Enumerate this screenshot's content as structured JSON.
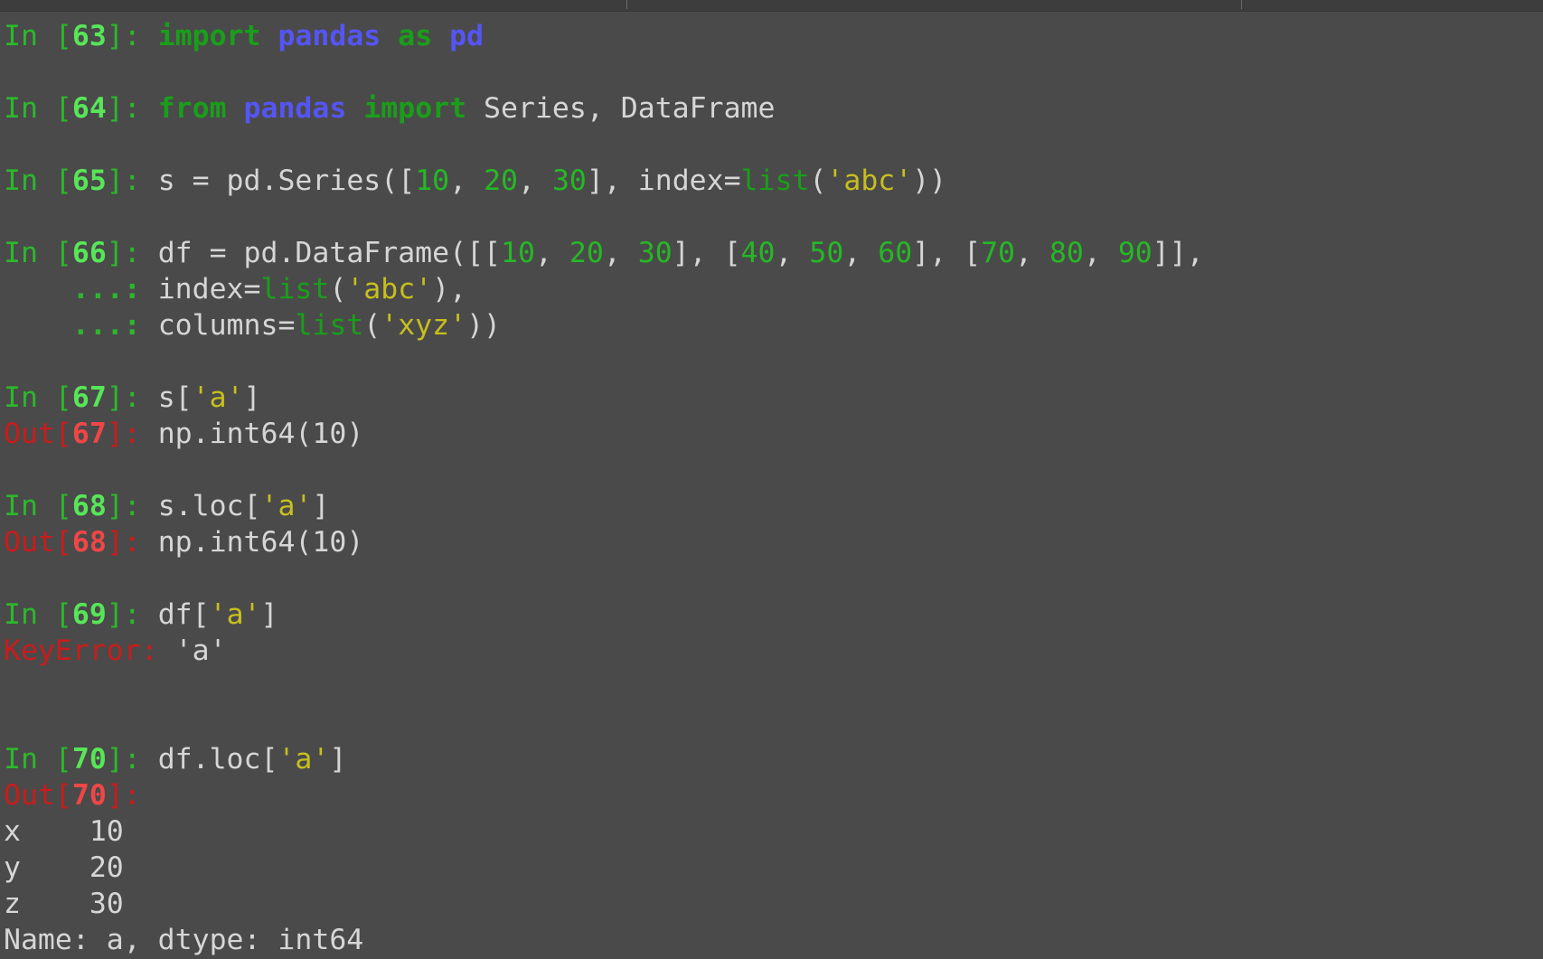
{
  "terminal": {
    "background": "#4a4a4a",
    "lines": [
      [
        [
          "tok-prompt-in",
          "In ["
        ],
        [
          "tok-prompt-num",
          "63"
        ],
        [
          "tok-prompt-in",
          "]: "
        ],
        [
          "tok-kw",
          "import"
        ],
        [
          "tok-plain",
          " "
        ],
        [
          "tok-mod",
          "pandas"
        ],
        [
          "tok-plain",
          " "
        ],
        [
          "tok-kw",
          "as"
        ],
        [
          "tok-plain",
          " "
        ],
        [
          "tok-mod",
          "pd"
        ]
      ],
      [
        [
          "tok-prompt-in",
          "In ["
        ],
        [
          "tok-prompt-num",
          "64"
        ],
        [
          "tok-prompt-in",
          "]: "
        ],
        [
          "tok-kw",
          "from"
        ],
        [
          "tok-plain",
          " "
        ],
        [
          "tok-mod",
          "pandas"
        ],
        [
          "tok-plain",
          " "
        ],
        [
          "tok-kw",
          "import"
        ],
        [
          "tok-plain",
          " Series, DataFrame"
        ]
      ],
      [
        [
          "tok-prompt-in",
          "In ["
        ],
        [
          "tok-prompt-num",
          "65"
        ],
        [
          "tok-prompt-in",
          "]: "
        ],
        [
          "tok-plain",
          "s = pd.Series(["
        ],
        [
          "tok-num",
          "10"
        ],
        [
          "tok-plain",
          ", "
        ],
        [
          "tok-num",
          "20"
        ],
        [
          "tok-plain",
          ", "
        ],
        [
          "tok-num",
          "30"
        ],
        [
          "tok-plain",
          "], index="
        ],
        [
          "tok-builtin",
          "list"
        ],
        [
          "tok-plain",
          "("
        ],
        [
          "tok-str",
          "'abc'"
        ],
        [
          "tok-plain",
          "))"
        ]
      ],
      [
        [
          "tok-prompt-in",
          "In ["
        ],
        [
          "tok-prompt-num",
          "66"
        ],
        [
          "tok-prompt-in",
          "]: "
        ],
        [
          "tok-plain",
          "df = pd.DataFrame([["
        ],
        [
          "tok-num",
          "10"
        ],
        [
          "tok-plain",
          ", "
        ],
        [
          "tok-num",
          "20"
        ],
        [
          "tok-plain",
          ", "
        ],
        [
          "tok-num",
          "30"
        ],
        [
          "tok-plain",
          "], ["
        ],
        [
          "tok-num",
          "40"
        ],
        [
          "tok-plain",
          ", "
        ],
        [
          "tok-num",
          "50"
        ],
        [
          "tok-plain",
          ", "
        ],
        [
          "tok-num",
          "60"
        ],
        [
          "tok-plain",
          "], ["
        ],
        [
          "tok-num",
          "70"
        ],
        [
          "tok-plain",
          ", "
        ],
        [
          "tok-num",
          "80"
        ],
        [
          "tok-plain",
          ", "
        ],
        [
          "tok-num",
          "90"
        ],
        [
          "tok-plain",
          "]],"
        ]
      ],
      [
        [
          "tok-plain",
          "    "
        ],
        [
          "tok-cont",
          "...: "
        ],
        [
          "tok-plain",
          "index="
        ],
        [
          "tok-builtin",
          "list"
        ],
        [
          "tok-plain",
          "("
        ],
        [
          "tok-str",
          "'abc'"
        ],
        [
          "tok-plain",
          "),"
        ]
      ],
      [
        [
          "tok-plain",
          "    "
        ],
        [
          "tok-cont",
          "...: "
        ],
        [
          "tok-plain",
          "columns="
        ],
        [
          "tok-builtin",
          "list"
        ],
        [
          "tok-plain",
          "("
        ],
        [
          "tok-str",
          "'xyz'"
        ],
        [
          "tok-plain",
          "))"
        ]
      ],
      [
        [
          "tok-prompt-in",
          "In ["
        ],
        [
          "tok-prompt-num",
          "67"
        ],
        [
          "tok-prompt-in",
          "]: "
        ],
        [
          "tok-plain",
          "s["
        ],
        [
          "tok-str",
          "'a'"
        ],
        [
          "tok-plain",
          "]"
        ]
      ],
      [
        [
          "tok-out",
          "Out["
        ],
        [
          "tok-out-num",
          "67"
        ],
        [
          "tok-out",
          "]: "
        ],
        [
          "tok-plain",
          "np.int64(10)"
        ]
      ],
      [
        [
          "tok-prompt-in",
          "In ["
        ],
        [
          "tok-prompt-num",
          "68"
        ],
        [
          "tok-prompt-in",
          "]: "
        ],
        [
          "tok-plain",
          "s.loc["
        ],
        [
          "tok-str",
          "'a'"
        ],
        [
          "tok-plain",
          "]"
        ]
      ],
      [
        [
          "tok-out",
          "Out["
        ],
        [
          "tok-out-num",
          "68"
        ],
        [
          "tok-out",
          "]: "
        ],
        [
          "tok-plain",
          "np.int64(10)"
        ]
      ],
      [
        [
          "tok-prompt-in",
          "In ["
        ],
        [
          "tok-prompt-num",
          "69"
        ],
        [
          "tok-prompt-in",
          "]: "
        ],
        [
          "tok-plain",
          "df["
        ],
        [
          "tok-str",
          "'a'"
        ],
        [
          "tok-plain",
          "]"
        ]
      ],
      [
        [
          "tok-err",
          "KeyError: "
        ],
        [
          "tok-plain",
          "'a'"
        ]
      ],
      [
        [
          "tok-prompt-in",
          "In ["
        ],
        [
          "tok-prompt-num",
          "70"
        ],
        [
          "tok-prompt-in",
          "]: "
        ],
        [
          "tok-plain",
          "df.loc["
        ],
        [
          "tok-str",
          "'a'"
        ],
        [
          "tok-plain",
          "]"
        ]
      ],
      [
        [
          "tok-out",
          "Out["
        ],
        [
          "tok-out-num",
          "70"
        ],
        [
          "tok-out",
          "]:"
        ]
      ],
      [
        [
          "tok-plain",
          "x    10"
        ]
      ],
      [
        [
          "tok-plain",
          "y    20"
        ]
      ],
      [
        [
          "tok-plain",
          "z    30"
        ]
      ],
      [
        [
          "tok-plain",
          "Name: a, dtype: int64"
        ]
      ]
    ]
  }
}
